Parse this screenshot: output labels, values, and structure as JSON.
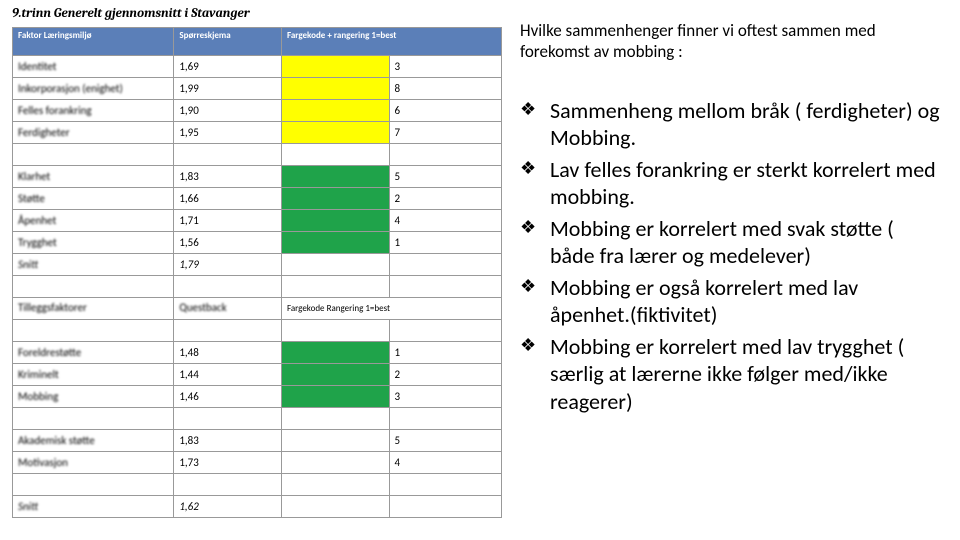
{
  "page_title": "9.trinn Generelt gjennomsnitt i Stavanger",
  "colors": {
    "header_bg": "#5b7fb8",
    "yellow": "#ffff00",
    "green": "#1fa34a"
  },
  "table1": {
    "headers": [
      "Faktor Læringsmiljø",
      "Spørreskjema",
      "Fargekode + rangering 1=best"
    ],
    "rows": [
      {
        "label": "Identitet",
        "score": "1,69",
        "color": "yellow",
        "rank": "3"
      },
      {
        "label": "Inkorporasjon (enighet)",
        "score": "1,99",
        "color": "yellow",
        "rank": "8"
      },
      {
        "label": "Felles forankring",
        "score": "1,90",
        "color": "yellow",
        "rank": "6"
      },
      {
        "label": "Ferdigheter",
        "score": "1,95",
        "color": "yellow",
        "rank": "7"
      },
      {
        "label": "Klarhet",
        "score": "1,83",
        "color": "green",
        "rank": "5"
      },
      {
        "label": "Støtte",
        "score": "1,66",
        "color": "green",
        "rank": "2"
      },
      {
        "label": "Åpenhet",
        "score": "1,71",
        "color": "green",
        "rank": "4"
      },
      {
        "label": "Trygghet",
        "score": "1,56",
        "color": "green",
        "rank": "1"
      }
    ],
    "average": {
      "label": "Snitt",
      "score": "1,79"
    }
  },
  "table2": {
    "headers": [
      "Tilleggsfaktorer",
      "Questback",
      "Fargekode Rangering 1=best"
    ],
    "rows": [
      {
        "label": "Foreldrestøtte",
        "score": "1,48",
        "color": "green",
        "rank": "1"
      },
      {
        "label": "Kriminelt",
        "score": "1,44",
        "color": "green",
        "rank": "2"
      },
      {
        "label": "Mobbing",
        "score": "1,46",
        "color": "green",
        "rank": "3"
      },
      {
        "label": "Akademisk støtte",
        "score": "1,83",
        "color": "white",
        "rank": "5"
      },
      {
        "label": "Motivasjon",
        "score": "1,73",
        "color": "white",
        "rank": "4"
      }
    ],
    "average": {
      "label": "Snitt",
      "score": "1,62"
    }
  },
  "right": {
    "intro": "Hvilke sammenhenger finner vi oftest sammen med forekomst av mobbing :",
    "bullets": [
      "Sammenheng mellom bråk ( ferdigheter) og Mobbing.",
      "Lav felles forankring er sterkt korrelert med mobbing.",
      "Mobbing er korrelert med svak støtte ( både fra lærer og medelever)",
      "Mobbing er også korrelert med lav åpenhet.(fiktivitet)",
      "Mobbing er korrelert med lav trygghet ( særlig at lærerne ikke følger med/ikke reagerer)"
    ]
  }
}
